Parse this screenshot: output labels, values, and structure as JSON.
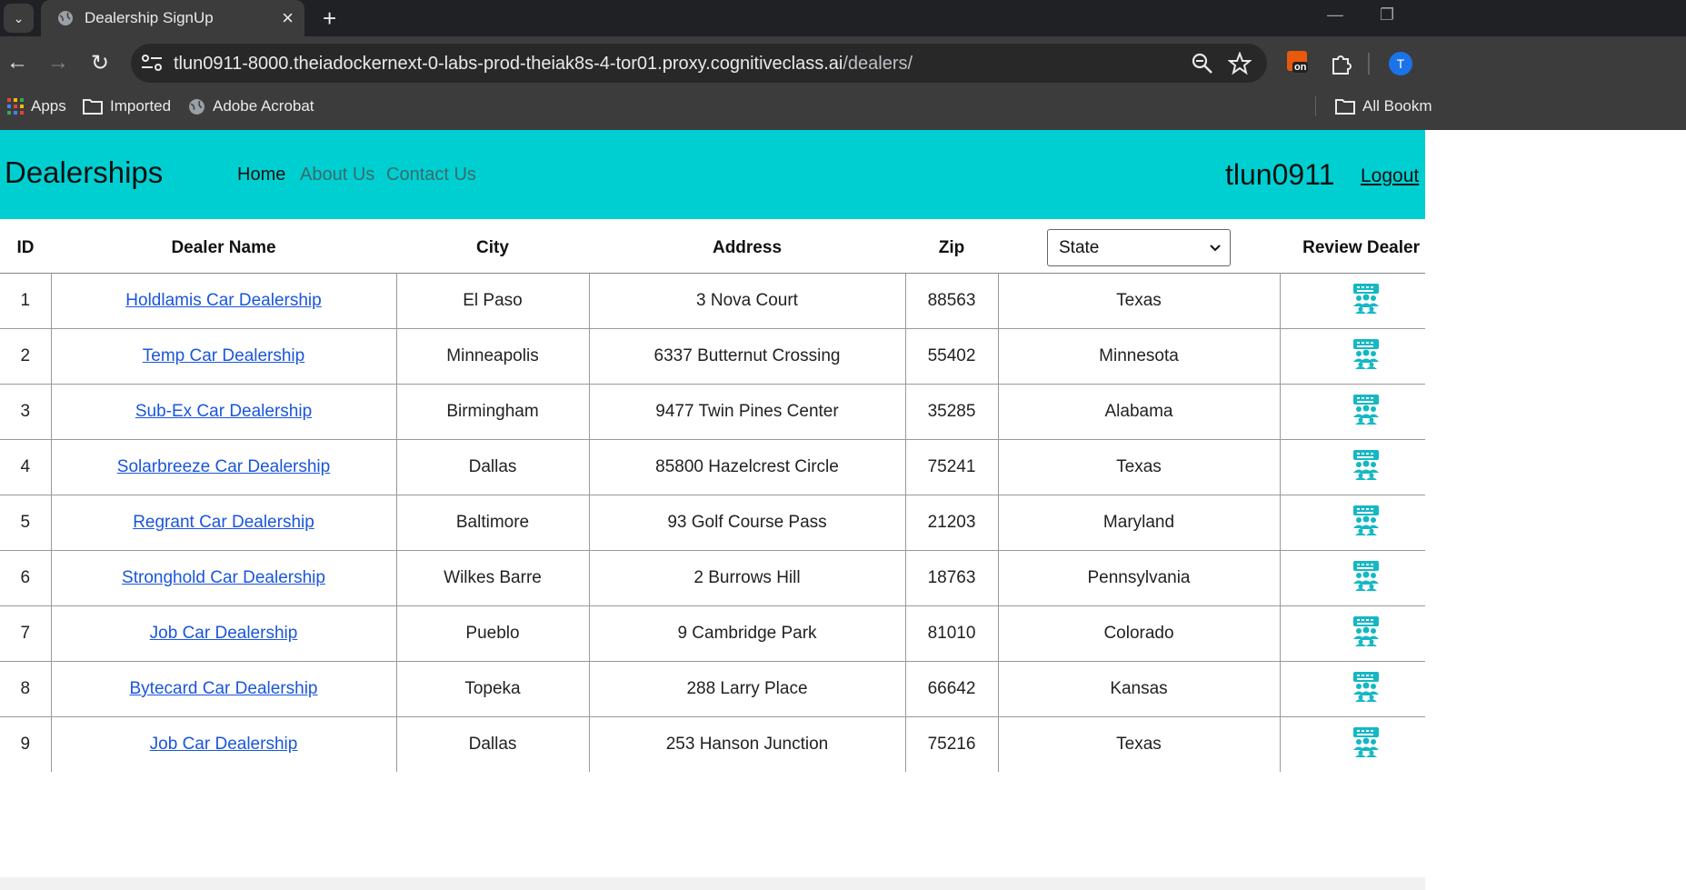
{
  "browser": {
    "tab_title": "Dealership SignUp",
    "url_host": "tlun0911-8000.theiadockernext-0-labs-prod-theiak8s-4-tor01.proxy.cognitiveclass.ai",
    "url_path": "/dealers/",
    "extension_badge": "on",
    "profile_initial": "T",
    "bookmarks": [
      {
        "label": "Apps",
        "icon": "apps-grid-icon"
      },
      {
        "label": "Imported",
        "icon": "folder-icon"
      },
      {
        "label": "Adobe Acrobat",
        "icon": "globe-icon"
      }
    ],
    "all_bookmarks": "All Bookm"
  },
  "navbar": {
    "brand": "Dealerships",
    "links": [
      "Home",
      "About Us",
      "Contact Us"
    ],
    "username": "tlun0911",
    "logout": "Logout",
    "bg_color": "#00cfd2"
  },
  "table": {
    "headers": {
      "id": "ID",
      "dealer_name": "Dealer Name",
      "city": "City",
      "address": "Address",
      "zip": "Zip",
      "state_select": "State",
      "review": "Review Dealer"
    },
    "review_icon": "review-people-icon",
    "rows": [
      {
        "id": "1",
        "name": "Holdlamis Car Dealership",
        "city": "El Paso",
        "address": "3 Nova Court",
        "zip": "88563",
        "state": "Texas"
      },
      {
        "id": "2",
        "name": "Temp Car Dealership",
        "city": "Minneapolis",
        "address": "6337 Butternut Crossing",
        "zip": "55402",
        "state": "Minnesota"
      },
      {
        "id": "3",
        "name": "Sub-Ex Car Dealership",
        "city": "Birmingham",
        "address": "9477 Twin Pines Center",
        "zip": "35285",
        "state": "Alabama"
      },
      {
        "id": "4",
        "name": "Solarbreeze Car Dealership",
        "city": "Dallas",
        "address": "85800 Hazelcrest Circle",
        "zip": "75241",
        "state": "Texas"
      },
      {
        "id": "5",
        "name": "Regrant Car Dealership",
        "city": "Baltimore",
        "address": "93 Golf Course Pass",
        "zip": "21203",
        "state": "Maryland"
      },
      {
        "id": "6",
        "name": "Stronghold Car Dealership",
        "city": "Wilkes Barre",
        "address": "2 Burrows Hill",
        "zip": "18763",
        "state": "Pennsylvania"
      },
      {
        "id": "7",
        "name": "Job Car Dealership",
        "city": "Pueblo",
        "address": "9 Cambridge Park",
        "zip": "81010",
        "state": "Colorado"
      },
      {
        "id": "8",
        "name": "Bytecard Car Dealership",
        "city": "Topeka",
        "address": "288 Larry Place",
        "zip": "66642",
        "state": "Kansas"
      },
      {
        "id": "9",
        "name": "Job Car Dealership",
        "city": "Dallas",
        "address": "253 Hanson Junction",
        "zip": "75216",
        "state": "Texas"
      }
    ]
  }
}
